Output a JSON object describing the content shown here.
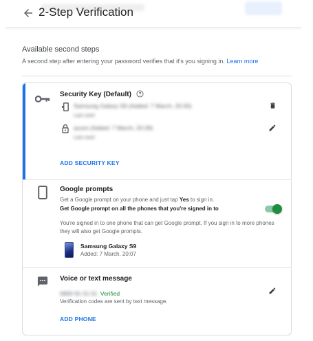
{
  "header": {
    "title": "2-Step Verification"
  },
  "intro": {
    "heading": "Available second steps",
    "description": "A second step after entering your password verifies that it's you signing in.",
    "learn_more": "Learn more"
  },
  "security_key": {
    "title": "Security Key (Default)",
    "keys": [
      {
        "name": "Samsung Galaxy S9 (Added: 7 March, 20:30)",
        "detail": "Last used"
      },
      {
        "name": "azure (Added: 7 March, 20:28)",
        "detail": "Last used"
      }
    ],
    "add_label": "ADD SECURITY KEY"
  },
  "google_prompts": {
    "title": "Google prompts",
    "line1_prefix": "Get a Google prompt on your phone and just tap ",
    "line1_bold": "Yes",
    "line1_suffix": " to sign in.",
    "line2": "Get Google prompt on all the phones that you're signed in to",
    "toggle_on": true,
    "info_line1": "You're signed in to one phone that can get Google prompt. If you sign in to more phones",
    "info_line2": "they will also get Google prompts.",
    "device": {
      "name": "Samsung Galaxy S9",
      "added": "Added: 7 March, 20:07"
    }
  },
  "voice_text": {
    "title": "Voice or text message",
    "phone_number": "0800 91 01 01",
    "status": "Verified",
    "note": "Verification codes are sent by text message.",
    "add_label": "ADD PHONE"
  },
  "colors": {
    "accent": "#1a73e8",
    "toggle_green": "#1e8e3e",
    "verified_green": "#1e8e3e"
  }
}
